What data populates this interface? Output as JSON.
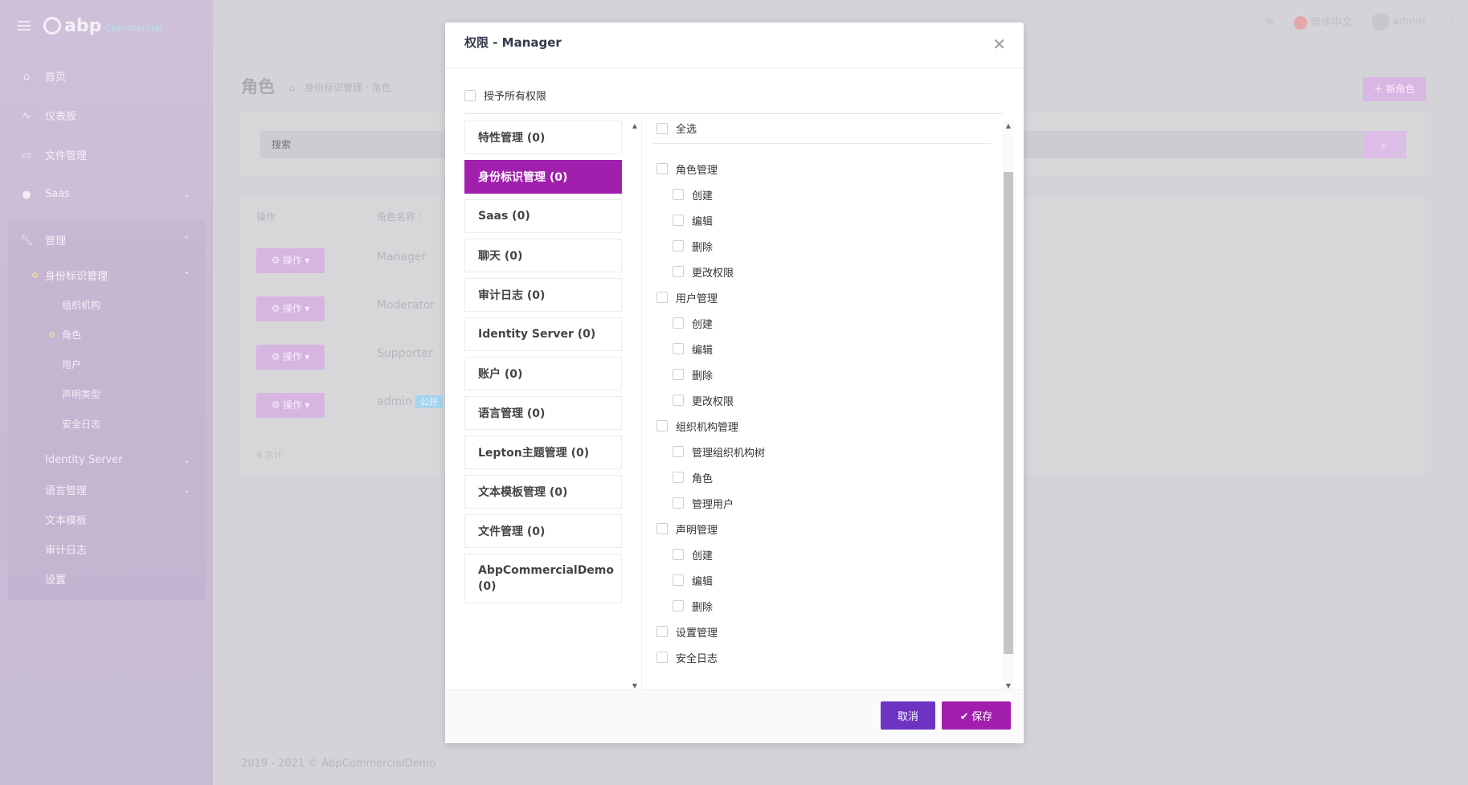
{
  "app": {
    "logo": "abp",
    "logo_sub": "Commercial"
  },
  "sidebar": {
    "items": [
      {
        "label": "首页",
        "icon": "home-icon"
      },
      {
        "label": "仪表板",
        "icon": "chart-icon"
      },
      {
        "label": "文件管理",
        "icon": "folder-icon"
      },
      {
        "label": "Saas",
        "icon": "users-icon"
      }
    ],
    "admin": {
      "label": "管理",
      "icon": "wrench-icon"
    },
    "identity": {
      "label": "身份标识管理"
    },
    "identity_children": [
      "组织机构",
      "角色",
      "用户",
      "声明类型",
      "安全日志"
    ],
    "rest": [
      {
        "label": "Identity Server"
      },
      {
        "label": "语言管理"
      },
      {
        "label": "文本模板"
      },
      {
        "label": "审计日志"
      },
      {
        "label": "设置"
      }
    ]
  },
  "topbar": {
    "language": "简体中文",
    "user": "admin"
  },
  "page": {
    "title": "角色",
    "breadcrumb": "身份标识管理 · 角色",
    "new_role": "新角色",
    "search_placeholder": "搜索",
    "col_actions": "操作",
    "col_name": "角色名称",
    "action_label": "操作",
    "roles": [
      "Manager",
      "Moderator",
      "Supporter",
      "admin"
    ],
    "public_badge": "公开",
    "total": "4 总计",
    "footer": "2019 - 2021 © AbpCommercialDemo"
  },
  "modal": {
    "title": "权限 - Manager",
    "grant_all": "授予所有权限",
    "groups": [
      "特性管理 (0)",
      "身份标识管理 (0)",
      "Saas (0)",
      "聊天 (0)",
      "审计日志 (0)",
      "Identity Server (0)",
      "账户 (0)",
      "语言管理 (0)",
      "Lepton主题管理 (0)",
      "文本模板管理 (0)",
      "文件管理 (0)",
      "AbpCommercialDemo (0)"
    ],
    "select_all": "全选",
    "permissions": [
      {
        "label": "角色管理",
        "level": 0
      },
      {
        "label": "创建",
        "level": 1
      },
      {
        "label": "编辑",
        "level": 1
      },
      {
        "label": "删除",
        "level": 1
      },
      {
        "label": "更改权限",
        "level": 1
      },
      {
        "label": "用户管理",
        "level": 0
      },
      {
        "label": "创建",
        "level": 1
      },
      {
        "label": "编辑",
        "level": 1
      },
      {
        "label": "删除",
        "level": 1
      },
      {
        "label": "更改权限",
        "level": 1
      },
      {
        "label": "组织机构管理",
        "level": 0
      },
      {
        "label": "管理组织机构树",
        "level": 1
      },
      {
        "label": "角色",
        "level": 1
      },
      {
        "label": "管理用户",
        "level": 1
      },
      {
        "label": "声明管理",
        "level": 0
      },
      {
        "label": "创建",
        "level": 1
      },
      {
        "label": "编辑",
        "level": 1
      },
      {
        "label": "删除",
        "level": 1
      },
      {
        "label": "设置管理",
        "level": 0
      },
      {
        "label": "安全日志",
        "level": 0
      }
    ],
    "cancel": "取消",
    "save": "保存"
  }
}
